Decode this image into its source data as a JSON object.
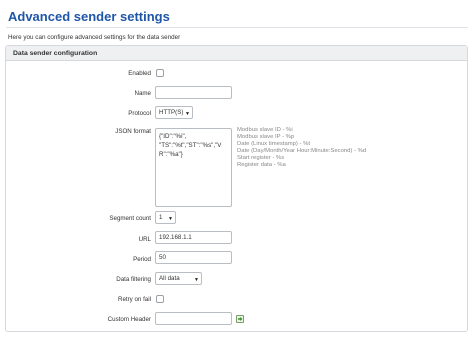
{
  "header": {
    "title": "Advanced sender settings",
    "description": "Here you can configure advanced settings for the data sender"
  },
  "panel": {
    "title": "Data sender configuration"
  },
  "form": {
    "enabled": {
      "label": "Enabled",
      "checked": false
    },
    "name": {
      "label": "Name",
      "value": ""
    },
    "protocol": {
      "label": "Protocol",
      "value": "HTTP(S)"
    },
    "json_format": {
      "label": "JSON format",
      "value": "{\"ID\":\"%i\",\n\"TS\":\"%t\",\"ST\":\"%s\",\"VR\":\"%a\"}",
      "hints": [
        "Modbus slave ID - %i",
        "Modbus slave IP - %p",
        "Date (Linux timestamp) - %t",
        "Date (Day/Month/Year Hour:Minute:Second) - %d",
        "Start register - %s",
        "Register data - %a"
      ]
    },
    "segment_count": {
      "label": "Segment count",
      "value": "1"
    },
    "url": {
      "label": "URL",
      "value": "192.168.1.1"
    },
    "period": {
      "label": "Period",
      "value": "50"
    },
    "data_filtering": {
      "label": "Data filtering",
      "value": "All data"
    },
    "retry_on_fail": {
      "label": "Retry on fail",
      "checked": false
    },
    "custom_header": {
      "label": "Custom Header",
      "value": ""
    }
  },
  "icons": {
    "add": "add-icon"
  },
  "colors": {
    "title": "#1f56a8",
    "panel_header": "#eef0f2",
    "add_icon": "#3d8b2f"
  }
}
